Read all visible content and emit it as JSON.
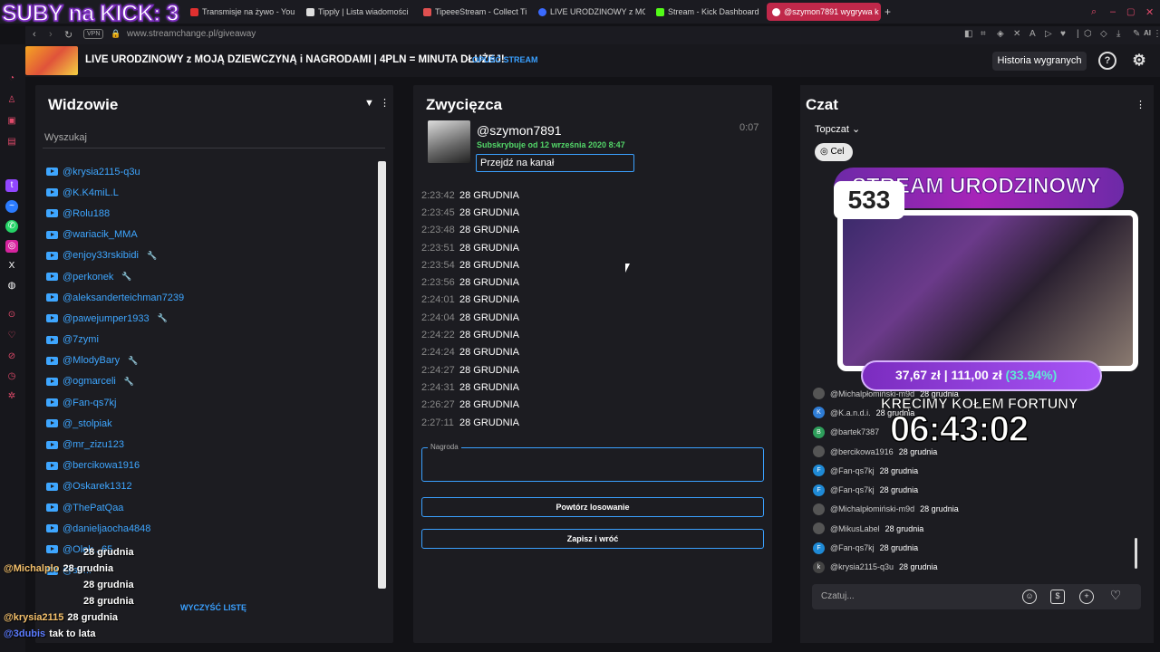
{
  "overlay_title": "SUBY na KICK: 3",
  "tabs": [
    {
      "label": "Transmisje na żywo - You",
      "color": "#e03030"
    },
    {
      "label": "Tipply | Lista wiadomości",
      "color": "#dddddd"
    },
    {
      "label": "TipeeeStream - Collect Ti",
      "color": "#e05050"
    },
    {
      "label": "LIVE URODZINOWY z MO",
      "color": "#3a6aff"
    },
    {
      "label": "Stream - Kick Dashboard",
      "color": "#53fc18"
    },
    {
      "label": "@szymon7891 wygrywa k",
      "color": "#ffffff"
    }
  ],
  "address": {
    "vpn": "VPN",
    "url": "www.streamchange.pl/giveaway"
  },
  "header": {
    "stream_title": "LIVE URODZINOWY z MOJĄ DZIEWCZYNĄ i NAGRODAMI | 4PLN = MINUTA DŁUŻEJ!",
    "leave_label": "OPUŚĆ STREAM",
    "history_label": "Historia wygranych"
  },
  "viewers": {
    "title": "Widzowie",
    "search_placeholder": "Wyszukaj",
    "clear_label": "WYCZYŚĆ LISTĘ",
    "items": [
      {
        "name": "@krysia2115-q3u",
        "mod": false
      },
      {
        "name": "@K.K4miL.L",
        "mod": false
      },
      {
        "name": "@Rolu188",
        "mod": false
      },
      {
        "name": "@wariacik_MMA",
        "mod": false
      },
      {
        "name": "@enjoy33rskibidi",
        "mod": true
      },
      {
        "name": "@perkonek",
        "mod": true
      },
      {
        "name": "@aleksanderteichman7239",
        "mod": false
      },
      {
        "name": "@pawejumper1933",
        "mod": true
      },
      {
        "name": "@7zymi",
        "mod": false
      },
      {
        "name": "@MlodyBary",
        "mod": true
      },
      {
        "name": "@ogmarceli",
        "mod": true
      },
      {
        "name": "@Fan-qs7kj",
        "mod": false
      },
      {
        "name": "@_stolpiak",
        "mod": false
      },
      {
        "name": "@mr_zizu123",
        "mod": false
      },
      {
        "name": "@bercikowa1916",
        "mod": false
      },
      {
        "name": "@Oskarek1312",
        "mod": false
      },
      {
        "name": "@ThePatQaa",
        "mod": false
      },
      {
        "name": "@danieljaocha4848",
        "mod": false
      },
      {
        "name": "@Olek...65",
        "mod": false
      },
      {
        "name": "@se...",
        "mod": false
      }
    ]
  },
  "winner": {
    "title": "Zwycięzca",
    "name": "@szymon7891",
    "subscription": "Subskrybuje od 12 września 2020 8:47",
    "elapsed": "0:07",
    "channel_button": "Przejdź na kanał",
    "entries": [
      {
        "time": "2:23:42",
        "date": "28 GRUDNIA"
      },
      {
        "time": "2:23:45",
        "date": "28 GRUDNIA"
      },
      {
        "time": "2:23:48",
        "date": "28 GRUDNIA"
      },
      {
        "time": "2:23:51",
        "date": "28 GRUDNIA"
      },
      {
        "time": "2:23:54",
        "date": "28 GRUDNIA"
      },
      {
        "time": "2:23:56",
        "date": "28 GRUDNIA"
      },
      {
        "time": "2:24:01",
        "date": "28 GRUDNIA"
      },
      {
        "time": "2:24:04",
        "date": "28 GRUDNIA"
      },
      {
        "time": "2:24:22",
        "date": "28 GRUDNIA"
      },
      {
        "time": "2:24:24",
        "date": "28 GRUDNIA"
      },
      {
        "time": "2:24:27",
        "date": "28 GRUDNIA"
      },
      {
        "time": "2:24:31",
        "date": "28 GRUDNIA"
      },
      {
        "time": "2:26:27",
        "date": "28 GRUDNIA"
      },
      {
        "time": "2:27:11",
        "date": "28 GRUDNIA"
      }
    ],
    "prize_label": "Nagroda",
    "prize_value": "",
    "repeat_label": "Powtórz losowanie",
    "save_label": "Zapisz i wróć"
  },
  "chat": {
    "title": "Czat",
    "filter_label": "Topczat",
    "goal_label": "Cel",
    "input_placeholder": "Czatuj...",
    "rows": [
      {
        "name": "@Michalpłomiński-m9d",
        "msg": "28 grudnia",
        "initial": "",
        "color": "#555555"
      },
      {
        "name": "@K.a.n.d.i.",
        "msg": "28 grudnia",
        "initial": "K",
        "color": "#2f7dd6"
      },
      {
        "name": "@bartek7387",
        "msg": "",
        "initial": "B",
        "color": "#2e9e5b"
      },
      {
        "name": "@bercikowa1916",
        "msg": "28 grudnia",
        "initial": "",
        "color": "#555555"
      },
      {
        "name": "@Fan-qs7kj",
        "msg": "28 grudnia",
        "initial": "F",
        "color": "#1f8ad6"
      },
      {
        "name": "@Fan-qs7kj",
        "msg": "28 grudnia",
        "initial": "F",
        "color": "#1f8ad6"
      },
      {
        "name": "@Michalpłomiński-m9d",
        "msg": "28 grudnia",
        "initial": "",
        "color": "#555555"
      },
      {
        "name": "@MikusLabel",
        "msg": "28 grudnia",
        "initial": "",
        "color": "#555555"
      },
      {
        "name": "@Fan-qs7kj",
        "msg": "28 grudnia",
        "initial": "F",
        "color": "#1f8ad6"
      },
      {
        "name": "@krysia2115-q3u",
        "msg": "28 grudnia",
        "initial": "k",
        "color": "#444444"
      }
    ]
  },
  "stream_overlay": {
    "banner": "STREAM URODZINOWY",
    "count": "533",
    "donation_current": "37,67 zł",
    "donation_separator": "|",
    "donation_goal": "111,00 zł",
    "donation_percent": "(33.94%)",
    "subtitle": "KRĘCIMY KOŁEM FORTUNY",
    "timer": "06:43:02"
  },
  "overlay_chat": [
    {
      "name": "",
      "msg": "28 grudnia"
    },
    {
      "name": "@Michalplo",
      "msg": "28 grudnia"
    },
    {
      "name": "",
      "msg": "28 grudnia"
    },
    {
      "name": "",
      "msg": "28 grudnia"
    },
    {
      "name": "@krysia2115",
      "msg": "28 grudnia"
    },
    {
      "name": "@3dubis",
      "msg": "tak to lata"
    }
  ]
}
